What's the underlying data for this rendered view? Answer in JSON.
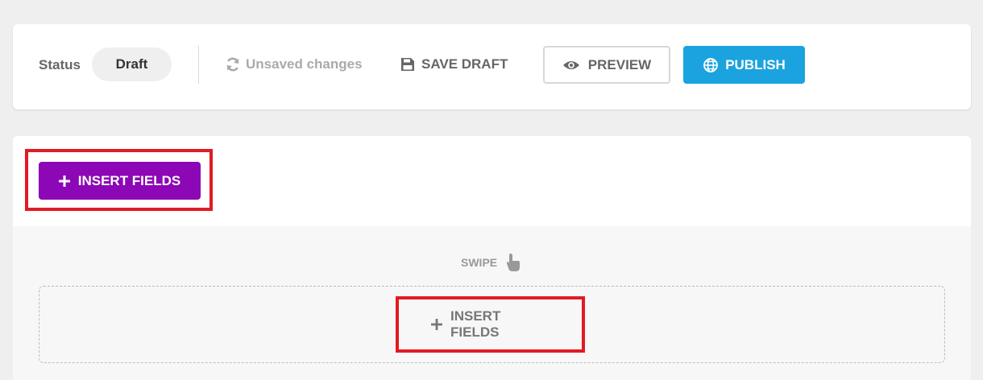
{
  "toolbar": {
    "status_label": "Status",
    "status_value": "Draft",
    "unsaved_text": "Unsaved changes",
    "save_draft_label": "SAVE DRAFT",
    "preview_label": "PREVIEW",
    "publish_label": "PUBLISH"
  },
  "editor": {
    "insert_fields_label": "INSERT FIELDS",
    "swipe_label": "SWIPE",
    "dropzone_insert_label": "INSERT FIELDS"
  },
  "icons": {
    "refresh": "refresh-icon",
    "save": "floppy-disk-icon",
    "preview": "eye-icon",
    "publish": "globe-icon",
    "insert": "plus-icon",
    "swipe": "hand-pointer-icon"
  },
  "colors": {
    "publish": "#1aa3de",
    "insert_fields": "#8c07b5",
    "highlight": "#e21a23",
    "status_pill": "#efefef"
  }
}
